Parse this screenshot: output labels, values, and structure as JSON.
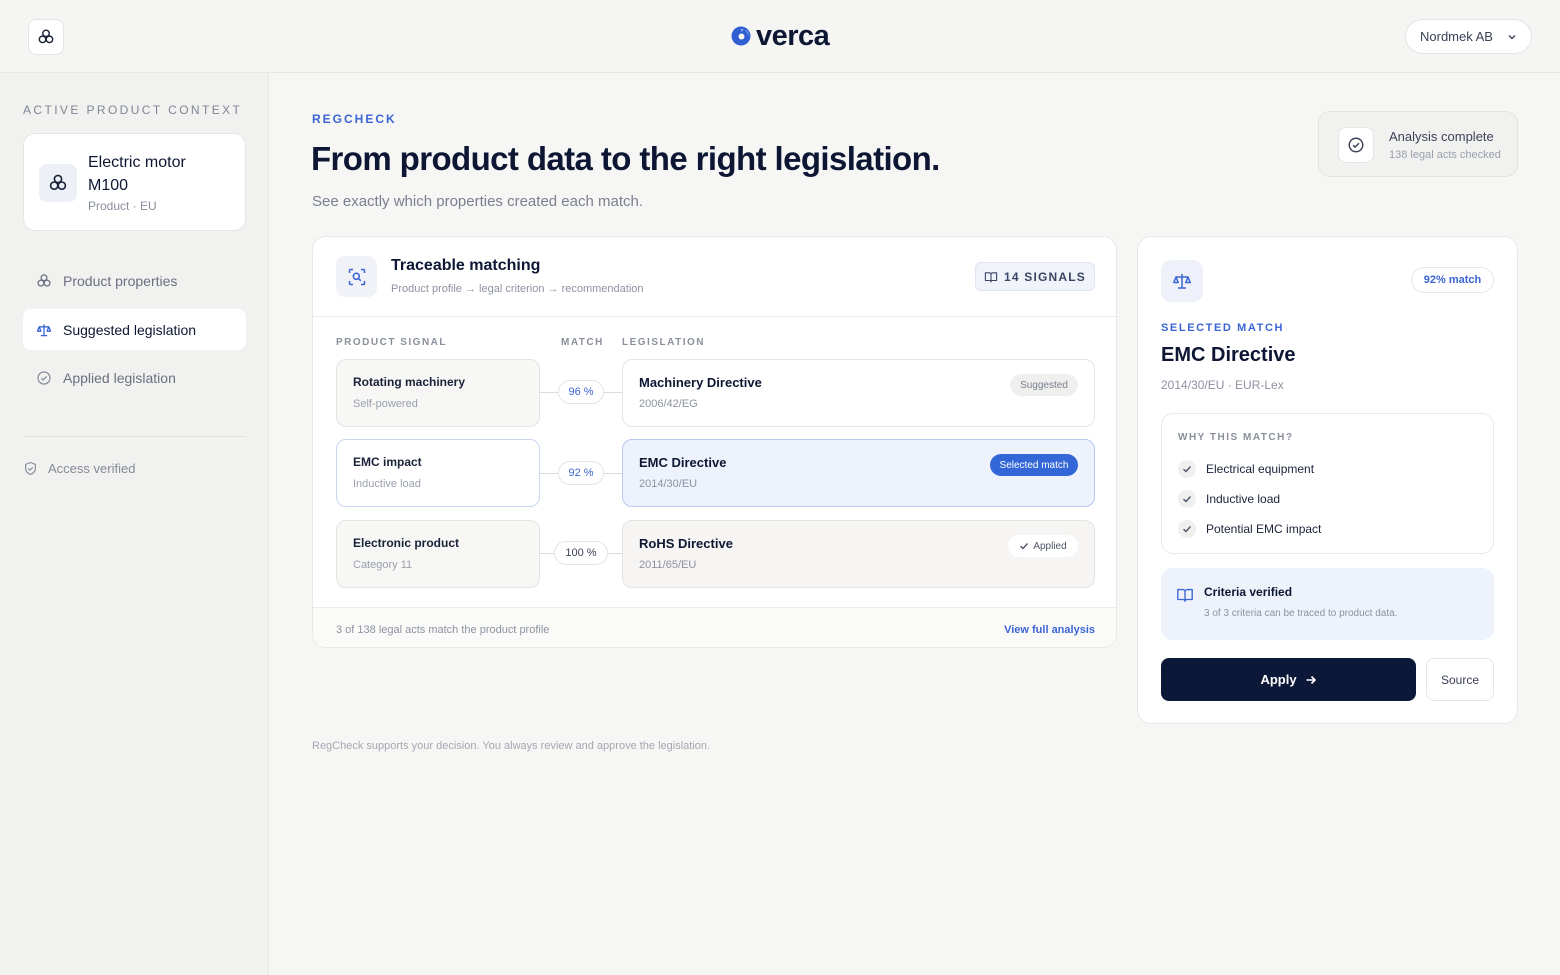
{
  "header": {
    "logo_text": "verca",
    "org_name": "Nordmek AB",
    "app_icon": "triskele-icon"
  },
  "sidebar": {
    "context_label": "ACTIVE PRODUCT CONTEXT",
    "product_name": "Electric motor M100",
    "product_sub": "Product · EU",
    "items": [
      {
        "label": "Product properties",
        "icon": "triskele-icon"
      },
      {
        "label": "Suggested legislation",
        "icon": "scale-icon",
        "active": true
      },
      {
        "label": "Applied legislation",
        "icon": "check-circle-icon"
      }
    ],
    "access": "Access verified"
  },
  "main": {
    "eyebrow": "REGCHECK",
    "title": "From product data to the right legislation.",
    "subtitle": "See exactly which properties created each match.",
    "status": {
      "title": "Analysis complete",
      "sub": "138 legal acts checked"
    }
  },
  "matching": {
    "title": "Traceable matching",
    "subtitle": "Product profile → legal criterion → recommendation",
    "signals": "14 SIGNALS",
    "col_signal": "PRODUCT SIGNAL",
    "col_match": "MATCH",
    "col_legislation": "LEGISLATION",
    "rows": [
      {
        "signal": "Rotating machinery",
        "signal_sub": "Self-powered",
        "match": "96 %",
        "law": "Machinery Directive",
        "law_ref": "2006/42/EG",
        "badge": "Suggested"
      },
      {
        "signal": "EMC impact",
        "signal_sub": "Inductive load",
        "match": "92 %",
        "law": "EMC Directive",
        "law_ref": "2014/30/EU",
        "badge": "Selected match"
      },
      {
        "signal": "Electronic product",
        "signal_sub": "Category 11",
        "match": "100 %",
        "law": "RoHS Directive",
        "law_ref": "2011/65/EU",
        "badge": "Applied"
      }
    ],
    "footer_text": "3 of 138 legal acts match the product profile",
    "footer_link": "View full analysis"
  },
  "detail": {
    "match_badge": "92% match",
    "eyebrow": "SELECTED MATCH",
    "title": "EMC Directive",
    "sub": "2014/30/EU · EUR-Lex",
    "why_label": "WHY THIS MATCH?",
    "reasons": [
      "Electrical equipment",
      "Inductive load",
      "Potential EMC impact"
    ],
    "verified_title": "Criteria verified",
    "verified_sub": "3 of 3 criteria can be traced to product data.",
    "apply_label": "Apply",
    "source_label": "Source"
  },
  "footnote": "RegCheck supports your decision. You always review and approve the legislation.",
  "colors": {
    "accent": "#3366d6",
    "navy": "#0c1838",
    "background": "#f6f6f5"
  }
}
